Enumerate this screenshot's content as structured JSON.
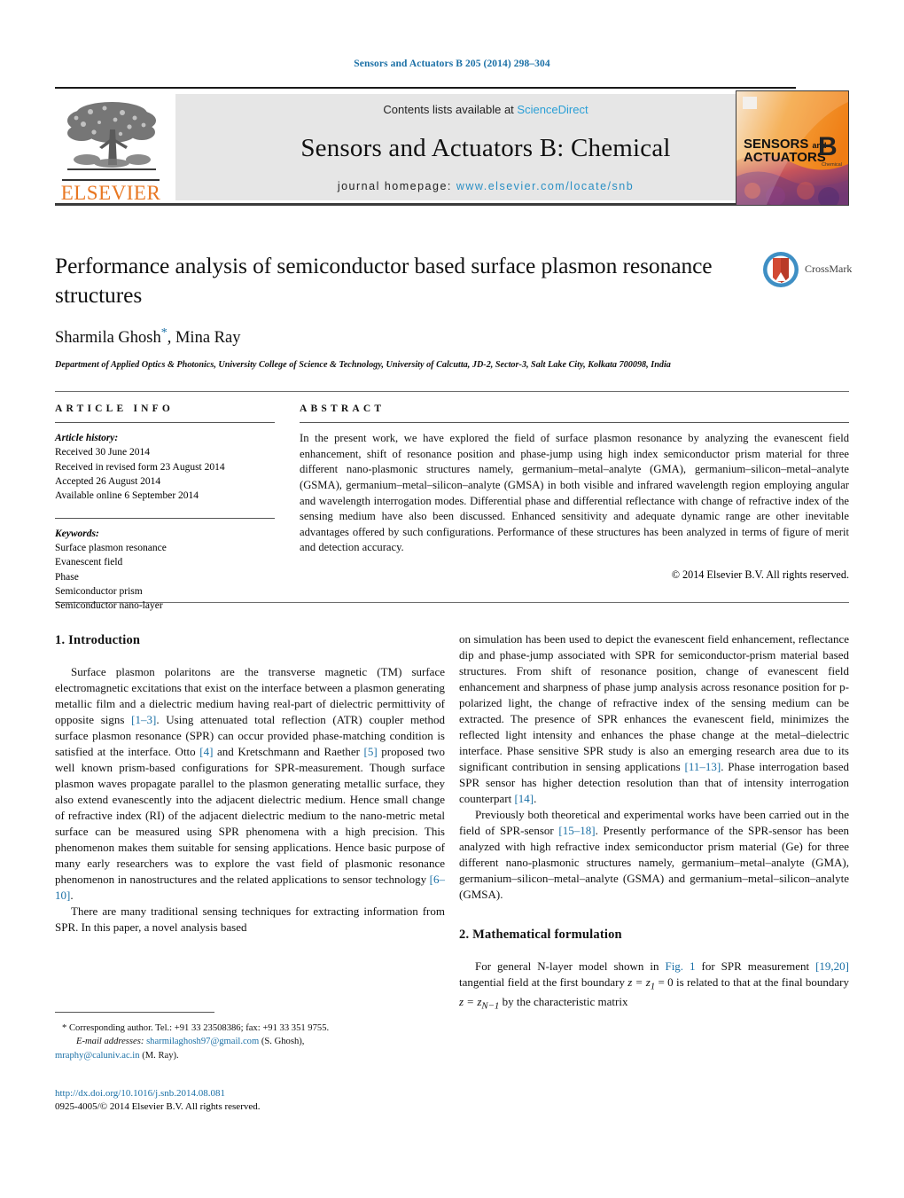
{
  "running_head": "Sensors and Actuators B 205 (2014) 298–304",
  "masthead": {
    "contents_prefix": "Contents lists available at ",
    "sciencedirect": "ScienceDirect",
    "journal_title": "Sensors and Actuators B: Chemical",
    "homepage_prefix": "journal homepage: ",
    "homepage_url": "www.elsevier.com/locate/snb",
    "publisher_wordmark": "ELSEVIER",
    "publisher_color": "#e87722",
    "link_color": "#2a9fd6",
    "cover": {
      "line1": "SENSORS",
      "line1_small": "and",
      "line2": "ACTUATORS",
      "letter": "B",
      "letter_sub": "Chemical"
    }
  },
  "article": {
    "title": "Performance analysis of semiconductor based surface plasmon resonance structures",
    "authors": "Sharmila Ghosh",
    "corresponding_marker": "*",
    "authors_rest": ", Mina Ray",
    "affiliation": "Department of Applied Optics & Photonics, University College of Science & Technology, University of Calcutta, JD-2, Sector-3, Salt Lake City, Kolkata 700098, India",
    "crossmark_label": "CrossMark"
  },
  "article_info": {
    "heading": "ARTICLE INFO",
    "history_label": "Article history:",
    "history": [
      "Received 30 June 2014",
      "Received in revised form 23 August 2014",
      "Accepted 26 August 2014",
      "Available online 6 September 2014"
    ],
    "keywords_label": "Keywords:",
    "keywords": [
      "Surface plasmon resonance",
      "Evanescent field",
      "Phase",
      "Semiconductor prism",
      "Semiconductor nano-layer"
    ]
  },
  "abstract": {
    "heading": "ABSTRACT",
    "body": "In the present work, we have explored the field of surface plasmon resonance by analyzing the evanescent field enhancement, shift of resonance position and phase-jump using high index semiconductor prism material for three different nano-plasmonic structures namely, germanium–metal–analyte (GMA), germanium–silicon–metal–analyte (GSMA), germanium–metal–silicon–analyte (GMSA) in both visible and infrared wavelength region employing angular and wavelength interrogation modes. Differential phase and differential reflectance with change of refractive index of the sensing medium have also been discussed. Enhanced sensitivity and adequate dynamic range are other inevitable advantages offered by such configurations. Performance of these structures has been analyzed in terms of figure of merit and detection accuracy.",
    "copyright": "© 2014 Elsevier B.V. All rights reserved."
  },
  "body": {
    "section1_heading": "1.  Introduction",
    "p1_a": "Surface plasmon polaritons are the transverse magnetic (TM) surface electromagnetic excitations that exist on the interface between a plasmon generating metallic film and a dielectric medium having real-part of dielectric permittivity of opposite signs ",
    "p1_ref1": "[1–3]",
    "p1_b": ". Using attenuated total reflection (ATR) coupler method surface plasmon resonance (SPR) can occur provided phase-matching condition is satisfied at the interface. Otto ",
    "p1_ref2": "[4]",
    "p1_c": " and Kretschmann and Raether ",
    "p1_ref3": "[5]",
    "p1_d": " proposed two well known prism-based configurations for SPR-measurement. Though surface plasmon waves propagate parallel to the plasmon generating metallic surface, they also extend evanescently into the adjacent dielectric medium. Hence small change of refractive index (RI) of the adjacent dielectric medium to the nano-metric metal surface can be measured using SPR phenomena with a high precision. This phenomenon makes them suitable for sensing applications. Hence basic purpose of many early researchers was to explore the vast field of plasmonic resonance phenomenon in nanostructures and the related applications to sensor technology ",
    "p1_ref4": "[6–10]",
    "p1_e": ".",
    "p2_a": "There are many traditional sensing techniques for extracting information from SPR. In this paper, a novel analysis based",
    "p3_a": "on simulation has been used to depict the evanescent field enhancement, reflectance dip and phase-jump associated with SPR for semiconductor-prism material based structures. From shift of resonance position, change of evanescent field enhancement and sharpness of phase jump analysis across resonance position for p-polarized light, the change of refractive index of the sensing medium can be extracted. The presence of SPR enhances the evanescent field, minimizes the reflected light intensity and enhances the phase change at the metal–dielectric interface. Phase sensitive SPR study is also an emerging research area due to its significant contribution in sensing applications ",
    "p3_ref1": "[11–13]",
    "p3_b": ". Phase interrogation based SPR sensor has higher detection resolution than that of intensity interrogation counterpart ",
    "p3_ref2": "[14]",
    "p3_c": ".",
    "p4_a": "Previously both theoretical and experimental works have been carried out in the field of SPR-sensor ",
    "p4_ref1": "[15–18]",
    "p4_b": ". Presently performance of the SPR-sensor has been analyzed with high refractive index semiconductor prism material (Ge) for three different nano-plasmonic structures namely, germanium–metal–analyte (GMA), germanium–silicon–metal–analyte (GSMA) and germanium–metal–silicon–analyte (GMSA).",
    "section2_heading": "2.  Mathematical formulation",
    "p5_a": "For general N-layer model shown in ",
    "p5_figref": "Fig. 1",
    "p5_b": " for SPR measurement ",
    "p5_ref1": "[19,20]",
    "p5_c": " tangential field at the first boundary ",
    "p5_eq1": "z = z",
    "p5_eq1sub": "1",
    "p5_eq1b": " = 0",
    "p5_d": " is related to that at the final boundary ",
    "p5_eq2": "z = z",
    "p5_eq2sub": "N−1",
    "p5_e": " by the characteristic matrix"
  },
  "footnote": {
    "marker": "*",
    "corresponding": "Corresponding author. Tel.: +91 33 23508386; fax: +91 33 351 9755.",
    "email_label": "E-mail addresses:",
    "email1": "sharmilaghosh97@gmail.com",
    "email1_owner": "(S. Ghosh),",
    "email2": "mraphy@caluniv.ac.in",
    "email2_owner": "(M. Ray).",
    "doi": "http://dx.doi.org/10.1016/j.snb.2014.08.081",
    "issn_line": "0925-4005/© 2014 Elsevier B.V. All rights reserved."
  }
}
